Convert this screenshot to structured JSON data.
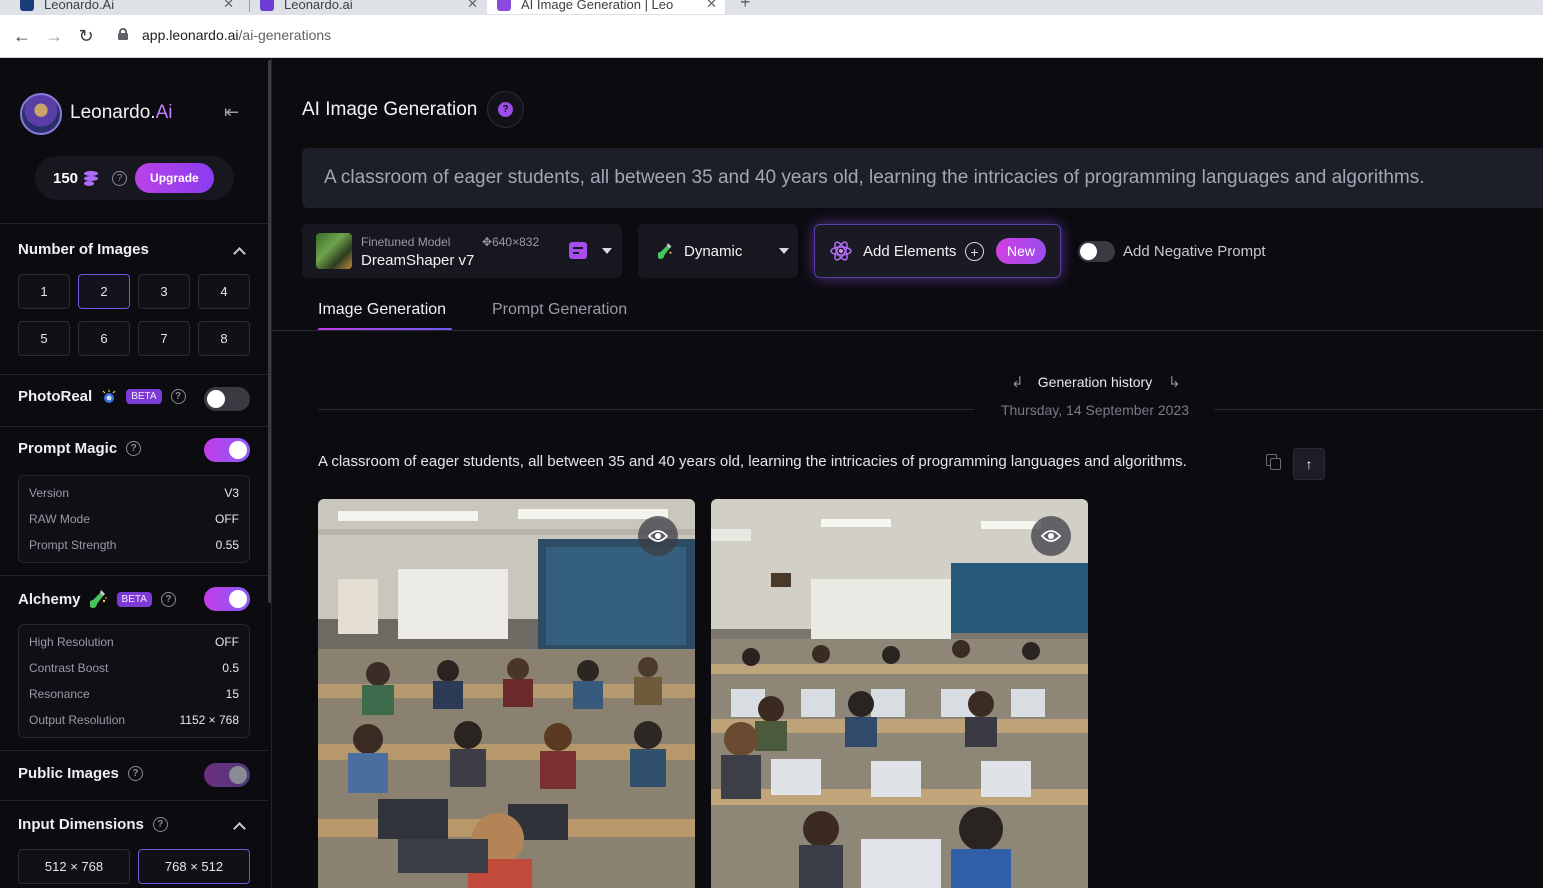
{
  "browser": {
    "tabs": [
      {
        "title": "Leonardo.Ai"
      },
      {
        "title": "Leonardo.ai"
      },
      {
        "title": "AI Image Generation | Leo"
      }
    ],
    "url_host": "app.leonardo.ai",
    "url_path": "/ai-generations"
  },
  "sidebar": {
    "brand_name": "Leonardo.",
    "brand_suffix": "Ai",
    "credits": "150",
    "upgrade_label": "Upgrade",
    "number_of_images": {
      "title": "Number of Images",
      "options": [
        "1",
        "2",
        "3",
        "4",
        "5",
        "6",
        "7",
        "8"
      ],
      "selected": "2"
    },
    "photoreal": {
      "label": "PhotoReal",
      "badge": "BETA",
      "enabled": false
    },
    "prompt_magic": {
      "label": "Prompt Magic",
      "enabled": true,
      "settings": [
        {
          "key": "Version",
          "value": "V3"
        },
        {
          "key": "RAW Mode",
          "value": "OFF"
        },
        {
          "key": "Prompt Strength",
          "value": "0.55"
        }
      ]
    },
    "alchemy": {
      "label": "Alchemy",
      "badge": "BETA",
      "enabled": true,
      "settings": [
        {
          "key": "High Resolution",
          "value": "OFF"
        },
        {
          "key": "Contrast Boost",
          "value": "0.5"
        },
        {
          "key": "Resonance",
          "value": "15"
        },
        {
          "key": "Output Resolution",
          "value": "1152 × 768"
        }
      ]
    },
    "public_images": {
      "label": "Public Images",
      "enabled": true
    },
    "input_dimensions": {
      "title": "Input Dimensions",
      "options": [
        "512 × 768",
        "768 × 512"
      ],
      "selected": "768 × 512"
    }
  },
  "main": {
    "title": "AI Image Generation",
    "prompt_text": "A classroom of eager students, all between 35 and 40 years old, learning the intricacies of programming languages and algorithms.",
    "model": {
      "sub_label": "Finetuned Model",
      "dims": "640×832",
      "name": "DreamShaper v7"
    },
    "style": {
      "label": "Dynamic"
    },
    "elements": {
      "label": "Add Elements",
      "badge": "New"
    },
    "negative_prompt": {
      "label": "Add Negative Prompt",
      "enabled": false
    },
    "tabs": [
      {
        "label": "Image Generation",
        "active": true
      },
      {
        "label": "Prompt Generation",
        "active": false
      }
    ],
    "history": {
      "label": "Generation history",
      "date": "Thursday, 14 September 2023"
    },
    "generation": {
      "prompt": "A classroom of eager students, all between 35 and 40 years old, learning the intricacies of programming languages and algorithms.",
      "image_count": 2
    }
  },
  "colors": {
    "accent_gradient_start": "#c13ce8",
    "accent_gradient_end": "#8b5cf6",
    "background": "#0b0b10"
  }
}
